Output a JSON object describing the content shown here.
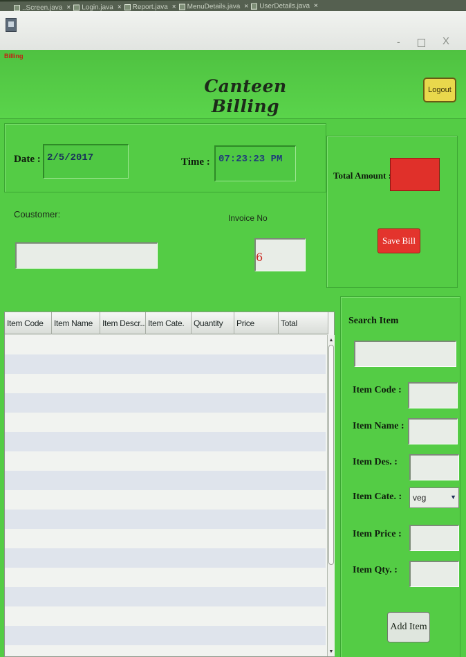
{
  "ide_tabs": [
    {
      "label": "..Screen.java"
    },
    {
      "label": "Login.java"
    },
    {
      "label": "Report.java"
    },
    {
      "label": "MenuDetails.java"
    },
    {
      "label": "UserDetails.java"
    }
  ],
  "window": {
    "frame_label": "Billing",
    "controls": {
      "minimize": "-",
      "close": "X"
    }
  },
  "header": {
    "title": "Canteen Billing",
    "logout_label": "Logout"
  },
  "datetime": {
    "date_label": "Date :",
    "date_value": "2/5/2017",
    "time_label": "Time :",
    "time_value": "07:23:23 PM"
  },
  "customer": {
    "label": "Coustomer:",
    "value": ""
  },
  "invoice": {
    "label": "Invoice No",
    "value": "6"
  },
  "totals": {
    "total_amount_label": "Total Amount :",
    "save_label": "Save Bill"
  },
  "table": {
    "columns": [
      "Item Code",
      "Item Name",
      "Item Descr...",
      "Item Cate.",
      "Quantity",
      "Price",
      "Total"
    ]
  },
  "search_panel": {
    "title": "Search Item",
    "fields": [
      {
        "label": "Item Code :"
      },
      {
        "label": "Item Name :"
      },
      {
        "label": "Item Des. :"
      },
      {
        "label": "Item Cate. :"
      },
      {
        "label": "Item Price :"
      },
      {
        "label": "Item Qty. :"
      }
    ],
    "category_selected": "veg",
    "add_label": "Add Item"
  },
  "colors": {
    "form_green": "#54cc45",
    "total_red": "#e0302a",
    "logout_yellow": "#e9d84c"
  }
}
